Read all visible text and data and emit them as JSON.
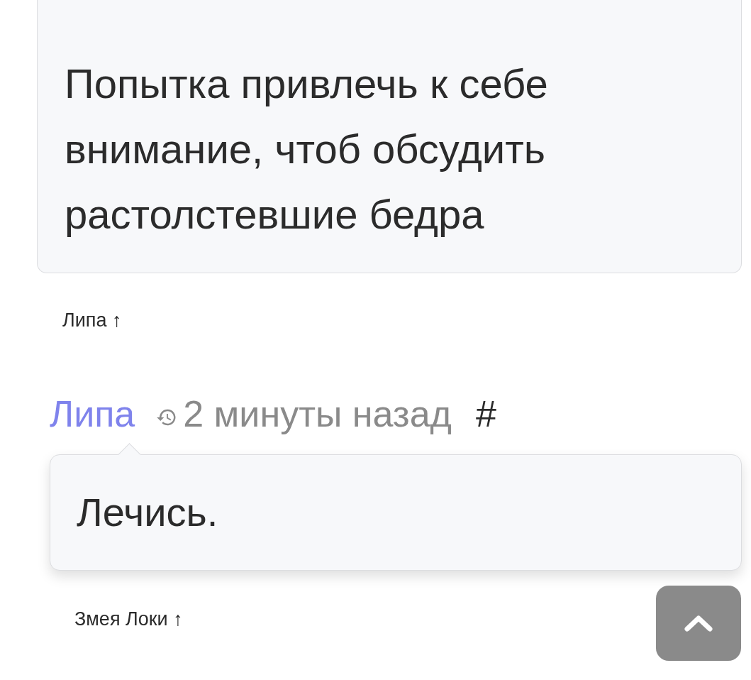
{
  "comments": [
    {
      "body": "Попытка привлечь к себе внимание, чтоб обсудить растолстевшие бедра",
      "parent_link": "Липа ↑"
    },
    {
      "author": "Липа",
      "time": "2 минуты назад",
      "anchor": "#",
      "body": "Лечись.",
      "parent_link": "Змея Локи ↑"
    }
  ]
}
